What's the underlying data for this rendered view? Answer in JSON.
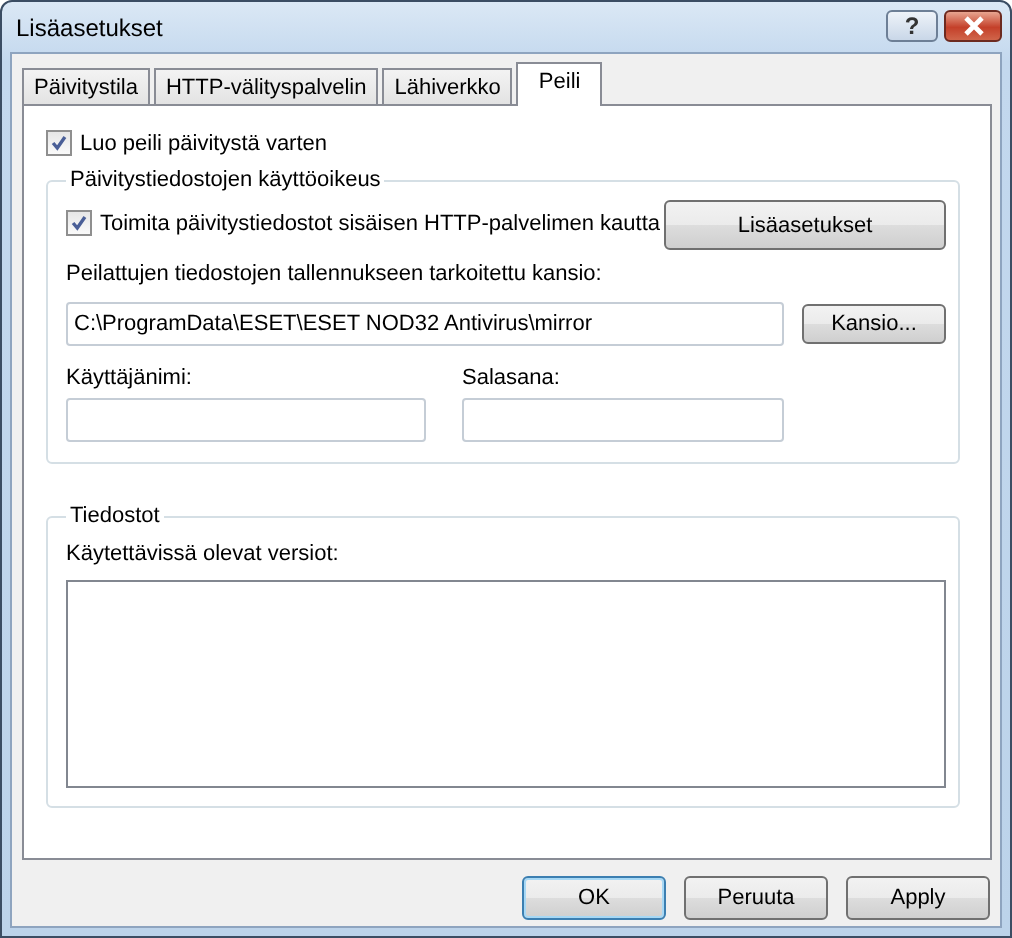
{
  "window": {
    "title": "Lisäasetukset",
    "help_button": "?"
  },
  "tabs": [
    {
      "label": "Päivitystila",
      "selected": false
    },
    {
      "label": "HTTP-välityspalvelin",
      "selected": false
    },
    {
      "label": "Lähiverkko",
      "selected": false
    },
    {
      "label": "Peili",
      "selected": true
    }
  ],
  "mirror_checkbox": {
    "label": "Luo peili päivitystä varten",
    "checked": true
  },
  "access_group": {
    "title": "Päivitystiedostojen käyttöoikeus",
    "http_checkbox": {
      "label": "Toimita päivitystiedostot sisäisen HTTP-palvelimen kautta",
      "checked": true
    },
    "advanced_button": "Lisäasetukset",
    "folder_label": "Peilattujen tiedostojen tallennukseen tarkoitettu kansio:",
    "folder_path": "C:\\ProgramData\\ESET\\ESET NOD32 Antivirus\\mirror",
    "browse_button": "Kansio...",
    "username_label": "Käyttäjänimi:",
    "password_label": "Salasana:"
  },
  "files_group": {
    "title": "Tiedostot",
    "versions_label": "Käytettävissä olevat versiot:"
  },
  "buttons": [
    {
      "label": "OK",
      "default": true
    },
    {
      "label": "Peruuta",
      "default": false
    },
    {
      "label": "Apply",
      "default": false
    }
  ]
}
